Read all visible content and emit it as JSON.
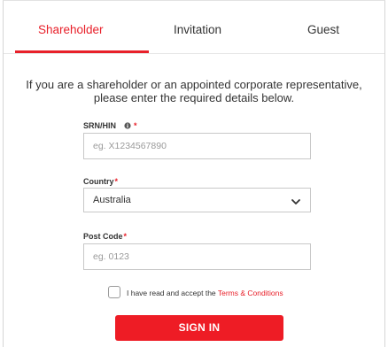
{
  "tabs": [
    {
      "label": "Shareholder",
      "active": true
    },
    {
      "label": "Invitation",
      "active": false
    },
    {
      "label": "Guest",
      "active": false
    }
  ],
  "intro": {
    "line1": "If you are a shareholder or an appointed corporate representative,",
    "line2": "please enter the required details below."
  },
  "srn": {
    "label": "SRN/HIN",
    "required_mark": "*",
    "icon": "info-icon",
    "placeholder": "eg. X1234567890",
    "value": ""
  },
  "country": {
    "label": "Country",
    "required_mark": "*",
    "selected": "Australia",
    "icon": "chevron-down-icon"
  },
  "postcode": {
    "label": "Post Code",
    "required_mark": "*",
    "placeholder": "eg. 0123",
    "value": ""
  },
  "terms": {
    "prefix": "I have read and accept the ",
    "link": "Terms & Conditions",
    "checked": false
  },
  "signin": {
    "label": "SIGN IN"
  },
  "colors": {
    "accent": "#e8202a",
    "button": "#ee1c25",
    "text": "#333333",
    "placeholder": "#9a9a9a",
    "border": "#c8c8c8"
  }
}
